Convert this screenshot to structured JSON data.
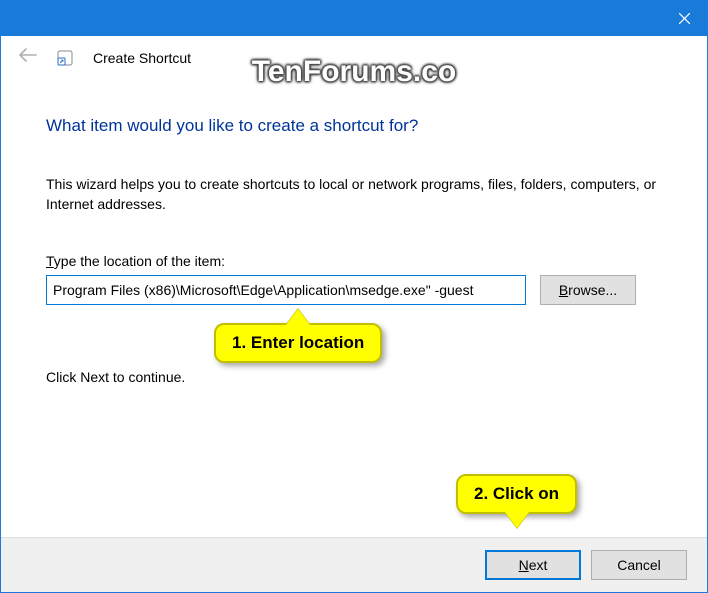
{
  "titlebar": {
    "close_label": "Close"
  },
  "header": {
    "title": "Create Shortcut"
  },
  "watermark": "TenForums.co",
  "content": {
    "heading": "What item would you like to create a shortcut for?",
    "description": "This wizard helps you to create shortcuts to local or network programs, files, folders, computers, or Internet addresses.",
    "input_label_prefix": "T",
    "input_label_rest": "ype the location of the item:",
    "location_value": "Program Files (x86)\\Microsoft\\Edge\\Application\\msedge.exe\" -guest",
    "browse_prefix": "B",
    "browse_rest": "rowse...",
    "continue_text": "Click Next to continue."
  },
  "buttons": {
    "next_prefix": "N",
    "next_rest": "ext",
    "cancel": "Cancel"
  },
  "callouts": {
    "c1": "1. Enter location",
    "c2": "2. Click on"
  }
}
